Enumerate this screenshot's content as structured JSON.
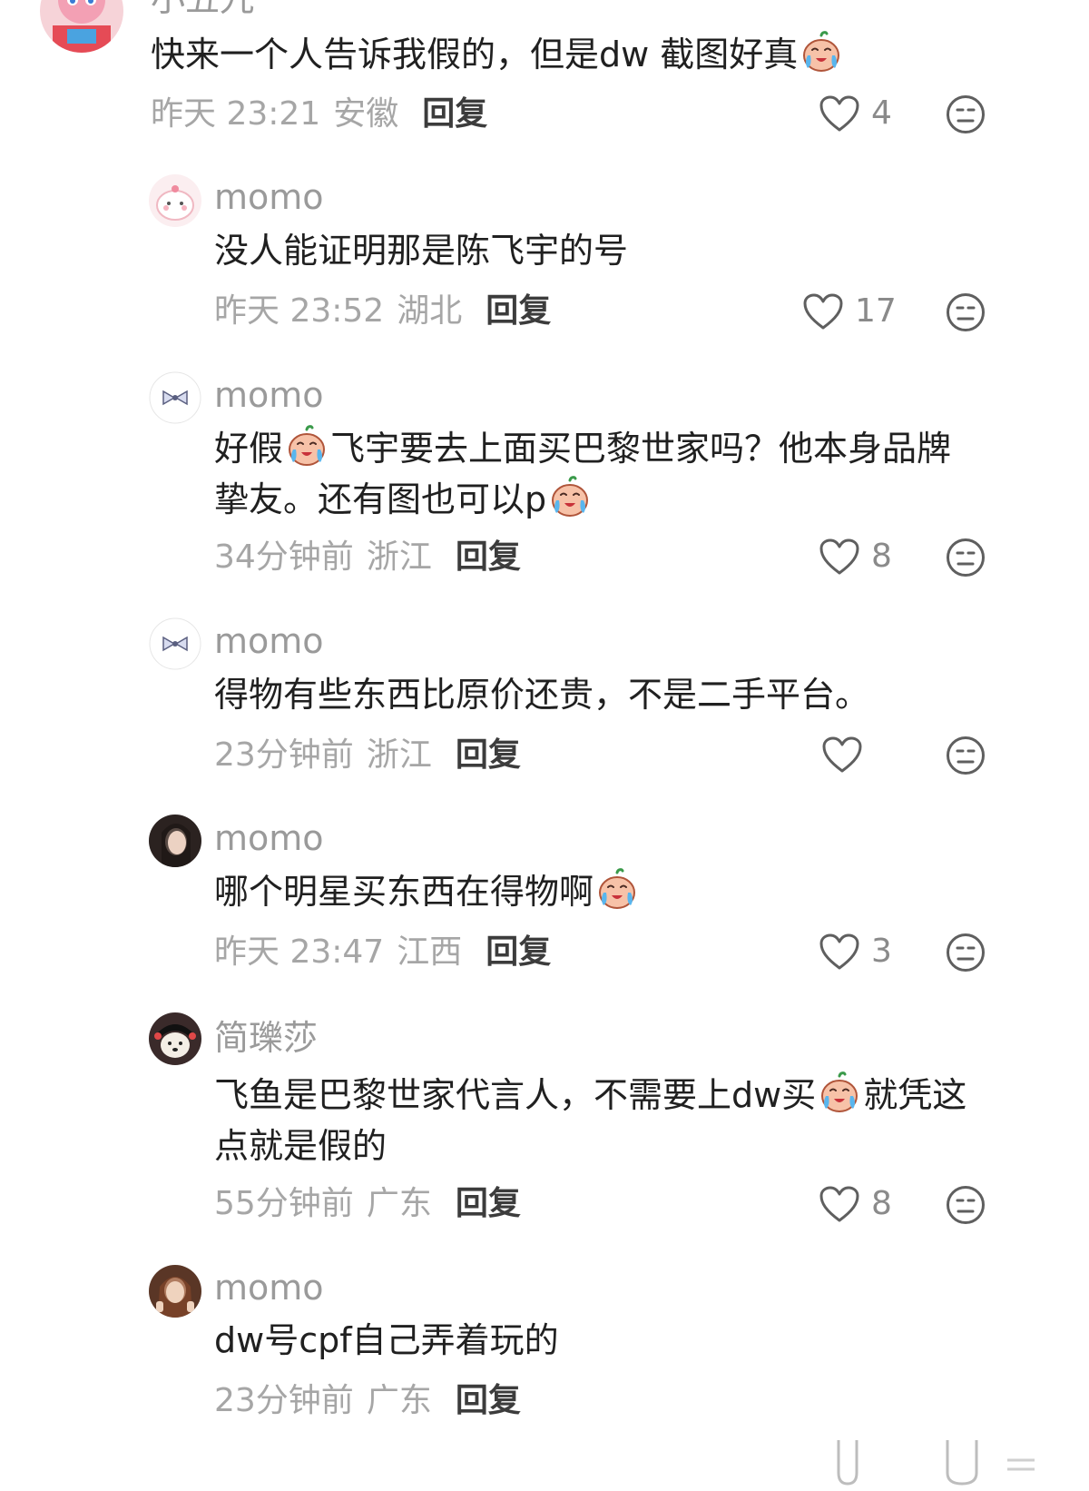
{
  "comments": [
    {
      "username": "小五九",
      "text_parts": [
        "快来一个人告诉我假的，但是dw 截图好真",
        ""
      ],
      "emoji": "crying-emoji",
      "time": "昨天 23:21",
      "location": "安徽",
      "reply_label": "回复",
      "likes": "4",
      "avatar": "pink-character-avatar"
    },
    {
      "username": "momo",
      "text": "没人能证明那是陈飞宇的号",
      "time": "昨天 23:52",
      "location": "湖北",
      "reply_label": "回复",
      "likes": "17",
      "avatar": "pink-blob-avatar"
    },
    {
      "username": "momo",
      "line1_a": "好假",
      "line1_b": "飞宇要去上面买巴黎世家吗？他本身品牌",
      "line2_a": "挚友。还有图也可以p",
      "time": "34分钟前",
      "location": "浙江",
      "reply_label": "回复",
      "likes": "8",
      "avatar": "bow-avatar"
    },
    {
      "username": "momo",
      "text": "得物有些东西比原价还贵，不是二手平台。",
      "time": "23分钟前",
      "location": "浙江",
      "reply_label": "回复",
      "likes": "",
      "avatar": "bow-avatar"
    },
    {
      "username": "momo",
      "text": "哪个明星买东西在得物啊",
      "time": "昨天 23:47",
      "location": "江西",
      "reply_label": "回复",
      "likes": "3",
      "avatar": "portrait-avatar"
    },
    {
      "username": "简瓅莎",
      "line1_a": "飞鱼是巴黎世家代言人，不需要上dw买",
      "line1_b": "就凭这",
      "line2_a": "点就是假的",
      "time": "55分钟前",
      "location": "广东",
      "reply_label": "回复",
      "likes": "8",
      "avatar": "dog-avatar"
    },
    {
      "username": "momo",
      "text": "dw号cpf自己弄着玩的",
      "time": "23分钟前",
      "location": "广东",
      "reply_label": "回复",
      "likes": "",
      "avatar": "portrait-avatar"
    }
  ],
  "colors": {
    "background": "#ffffff",
    "username": "#9a9a9a",
    "text": "#202020",
    "meta": "#a6a6a6",
    "reply": "#3c3c3c",
    "icon": "#6b6b6b"
  }
}
